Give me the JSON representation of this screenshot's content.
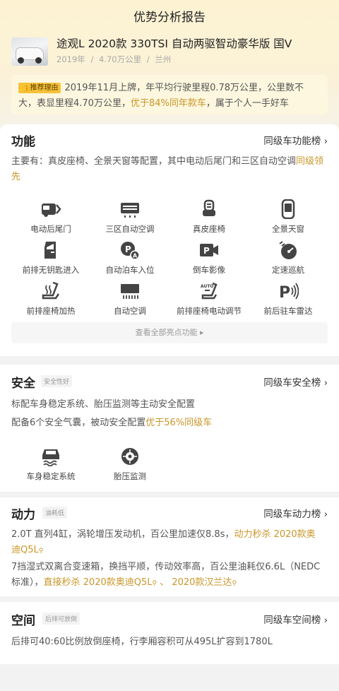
{
  "header": {
    "title": "优势分析报告"
  },
  "car": {
    "name": "途观L 2020款 330TSI 自动两驱智动豪华版 国V",
    "year": "2019年",
    "mileage": "4.70万公里",
    "city": "兰州",
    "sep": "/"
  },
  "reason": {
    "badge": "推荐理由",
    "text_before": "2019年11月上牌，年平均行驶里程0.78万公里，公里数不大，表显里程4.70万公里，",
    "highlight": "优于84%同年款车",
    "text_after": "，属于个人一手好车"
  },
  "features": {
    "title": "功能",
    "rank": "同级车功能榜 ›",
    "summary_before": "主要有：真皮座椅、全景天窗等配置，其中电动后尾门和三区自动空调",
    "summary_highlight": "同级领先",
    "items": [
      {
        "label": "电动后尾门",
        "icon": "tailgate-icon"
      },
      {
        "label": "三区自动空调",
        "icon": "ac-icon"
      },
      {
        "label": "真皮座椅",
        "icon": "seat-icon"
      },
      {
        "label": "全景天窗",
        "icon": "sunroof-icon"
      },
      {
        "label": "前排无钥匙进入",
        "icon": "keyless-entry-icon"
      },
      {
        "label": "自动泊车入位",
        "icon": "auto-parking-icon"
      },
      {
        "label": "倒车影像",
        "icon": "camera-icon"
      },
      {
        "label": "定速巡航",
        "icon": "cruise-icon"
      },
      {
        "label": "前排座椅加热",
        "icon": "seat-heating-icon"
      },
      {
        "label": "自动空调",
        "icon": "auto-ac-icon"
      },
      {
        "label": "前排座椅电动调节",
        "icon": "seat-adjust-icon"
      },
      {
        "label": "前后驻车雷达",
        "icon": "parking-radar-icon"
      }
    ],
    "view_all": "查看全部亮点功能 ▸"
  },
  "safety": {
    "title": "安全",
    "tag": "安全性好",
    "rank": "同级车安全榜 ›",
    "line1": "标配车身稳定系统、胎压监测等主动安全配置",
    "line2_before": "配备6个安全气囊，被动安全配置",
    "line2_highlight": "优于56%同级车",
    "items": [
      {
        "label": "车身稳定系统",
        "icon": "stability-icon"
      },
      {
        "label": "胎压监测",
        "icon": "tire-pressure-icon"
      }
    ]
  },
  "power": {
    "title": "动力",
    "tag": "油耗低",
    "rank": "同级车动力榜 ›",
    "p1_text": "2.0T 直列4缸，涡轮增压发动机，百公里加速仅8.8s，",
    "p1_highlight1": "动力秒杀 2020款奥",
    "p1_highlight2": "迪Q5L",
    "p2_text1": "7挡湿式双离合变速箱，换挡平顺，传动效率高，百公里油耗仅6.6L（NEDC",
    "p2_text2": "标准），",
    "p2_highlight1": "直接秒杀 2020款奥迪Q5L",
    "p2_sep": " 、 ",
    "p2_highlight2": "2020款汉兰达"
  },
  "space": {
    "title": "空间",
    "tag": "后排可放倒",
    "rank": "同级车空间榜 ›",
    "text": "后排可40:60比例放倒座椅，行李厢容积可从495L扩容到1780L"
  }
}
